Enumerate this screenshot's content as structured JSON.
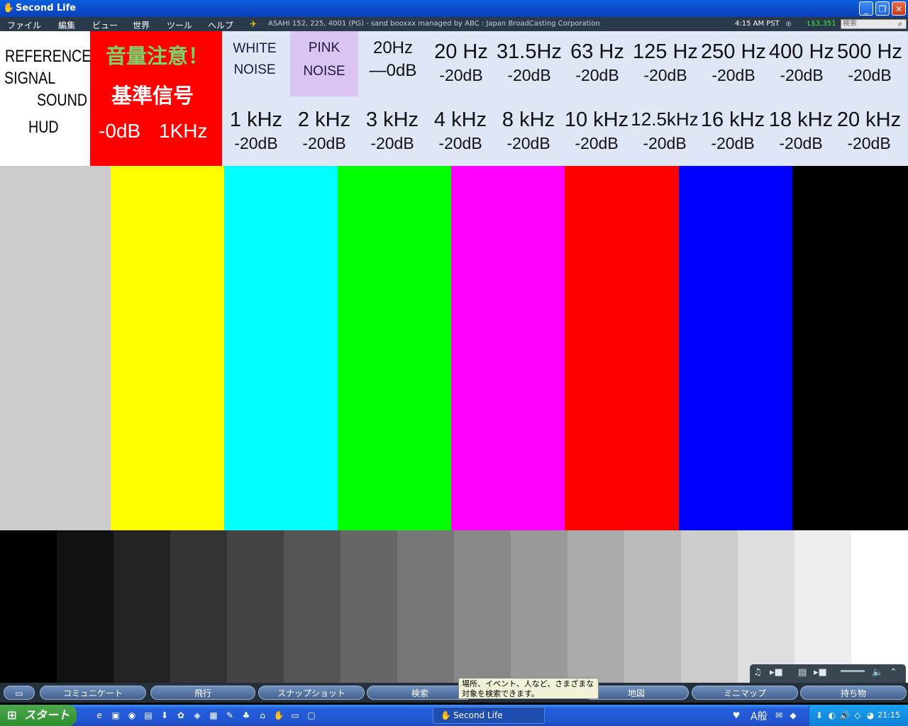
{
  "window": {
    "title": "Second Life"
  },
  "menu": {
    "items": [
      "ファイル",
      "編集",
      "ビュー",
      "世界",
      "ツール",
      "ヘルプ"
    ],
    "location_info": "ASAHI 152, 225, 4001 (PG) - sand booxxx managed by  ABC : Japan BroadCasting Corporation",
    "clock": "4:15 AM PST",
    "balance": "L$3,351",
    "search_placeholder": "検索"
  },
  "hud": {
    "ref_title": [
      "REFERENCE",
      "SIGNAL",
      "SOUND",
      "HUD"
    ],
    "caution": "音量注意！",
    "reference": "基準信号",
    "ref_level": "-0dB",
    "ref_freq": "1KHz",
    "white_noise": [
      "WHITE",
      "NOISE"
    ],
    "pink_noise": [
      "PINK",
      "NOISE"
    ],
    "row1": [
      {
        "freq": "20Hz",
        "db": "—0dB"
      },
      {
        "freq": "20  Hz",
        "db": "-20dB"
      },
      {
        "freq": "31.5Hz",
        "db": "-20dB"
      },
      {
        "freq": "63  Hz",
        "db": "-20dB"
      },
      {
        "freq": "125 Hz",
        "db": "-20dB"
      },
      {
        "freq": "250 Hz",
        "db": "-20dB"
      },
      {
        "freq": "400 Hz",
        "db": "-20dB"
      },
      {
        "freq": "500 Hz",
        "db": "-20dB"
      }
    ],
    "row2": [
      {
        "freq": "1  kHz",
        "db": "-20dB"
      },
      {
        "freq": "2  kHz",
        "db": "-20dB"
      },
      {
        "freq": "3  kHz",
        "db": "-20dB"
      },
      {
        "freq": "4  kHz",
        "db": "-20dB"
      },
      {
        "freq": "8  kHz",
        "db": "-20dB"
      },
      {
        "freq": "10 kHz",
        "db": "-20dB"
      },
      {
        "freq": "12.5kHz",
        "db": "-20dB"
      },
      {
        "freq": "16  kHz",
        "db": "-20dB"
      },
      {
        "freq": "18  kHz",
        "db": "-20dB"
      },
      {
        "freq": "20  kHz",
        "db": "-20dB"
      }
    ]
  },
  "color_bars": [
    "#cccccc",
    "#ffff00",
    "#00ffff",
    "#00ff00",
    "#ff00ff",
    "#ff0000",
    "#0000ff",
    "#000000"
  ],
  "gray_steps": [
    "#000000",
    "#111111",
    "#222222",
    "#333333",
    "#444444",
    "#555555",
    "#666666",
    "#777777",
    "#888888",
    "#999999",
    "#aaaaaa",
    "#bbbbbb",
    "#cccccc",
    "#dddddd",
    "#eeeeee",
    "#ffffff"
  ],
  "tooltip": "場所、イベント、人など、さまざまな対象を検索できます。",
  "toolbar": {
    "communicate": "コミュニケート",
    "fly": "飛行",
    "snapshot": "スナップショット",
    "search": "検索",
    "map": "地図",
    "minimap": "ミニマップ",
    "inventory": "持ち物"
  },
  "taskbar": {
    "start": "スタート",
    "task_second_life": "Second Life",
    "ime": "A般",
    "time": "21:15"
  }
}
